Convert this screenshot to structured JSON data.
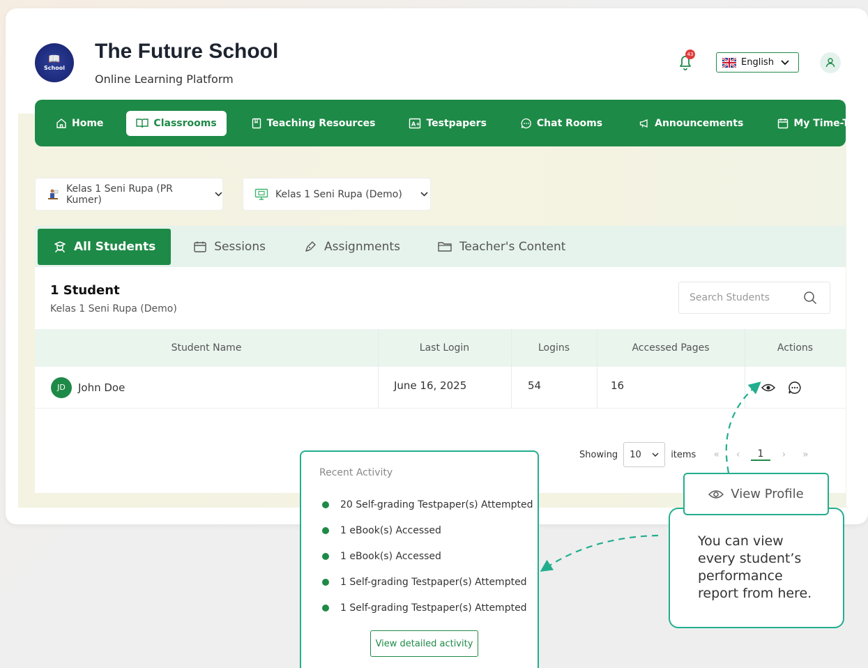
{
  "header": {
    "school_name": "The Future School",
    "subtitle": "Online Learning Platform",
    "logo_text": "School",
    "notification_count": "43",
    "language": "English"
  },
  "nav": {
    "items": [
      {
        "label": "Home",
        "icon": "home-icon"
      },
      {
        "label": "Classrooms",
        "icon": "book-open-icon",
        "active": true
      },
      {
        "label": "Teaching Resources",
        "icon": "bookmark-book-icon"
      },
      {
        "label": "Testpapers",
        "icon": "grade-icon"
      },
      {
        "label": "Chat Rooms",
        "icon": "chat-icon"
      },
      {
        "label": "Announcements",
        "icon": "megaphone-icon"
      },
      {
        "label": "My Time-Table",
        "icon": "calendar-icon"
      }
    ]
  },
  "selects": {
    "school_class": "Kelas 1 Seni Rupa (PR Kumer)",
    "classroom": "Kelas 1 Seni Rupa (Demo)"
  },
  "tabs": [
    {
      "label": "All Students",
      "active": true
    },
    {
      "label": "Sessions"
    },
    {
      "label": "Assignments"
    },
    {
      "label": "Teacher's Content"
    }
  ],
  "panel": {
    "count_title": "1 Student",
    "count_sub": "Kelas 1 Seni Rupa (Demo)",
    "search_placeholder": "Search Students"
  },
  "table": {
    "headers": [
      "Student Name",
      "Last Login",
      "Logins",
      "Accessed Pages",
      "Actions"
    ],
    "rows": [
      {
        "initials": "JD",
        "name": "John Doe",
        "last_login": "June 16, 2025",
        "logins": "54",
        "accessed_pages": "16"
      }
    ]
  },
  "pagination": {
    "showing_label": "Showing",
    "per_page": "10",
    "items_label": "items",
    "page": "1"
  },
  "recent_activity": {
    "title": "Recent Activity",
    "items": [
      "20 Self-grading Testpaper(s) Attempted",
      "1 eBook(s) Accessed",
      "1 eBook(s) Accessed",
      "1 Self-grading Testpaper(s) Attempted",
      "1 Self-grading Testpaper(s) Attempted"
    ],
    "button": "View detailed activity"
  },
  "callout": {
    "view_profile": "View Profile",
    "tip": "You can view every student’s performance report from here."
  },
  "colors": {
    "primary": "#1e8a47",
    "callout_border": "#22ae8e",
    "tab_bg": "#e6f3ec"
  }
}
